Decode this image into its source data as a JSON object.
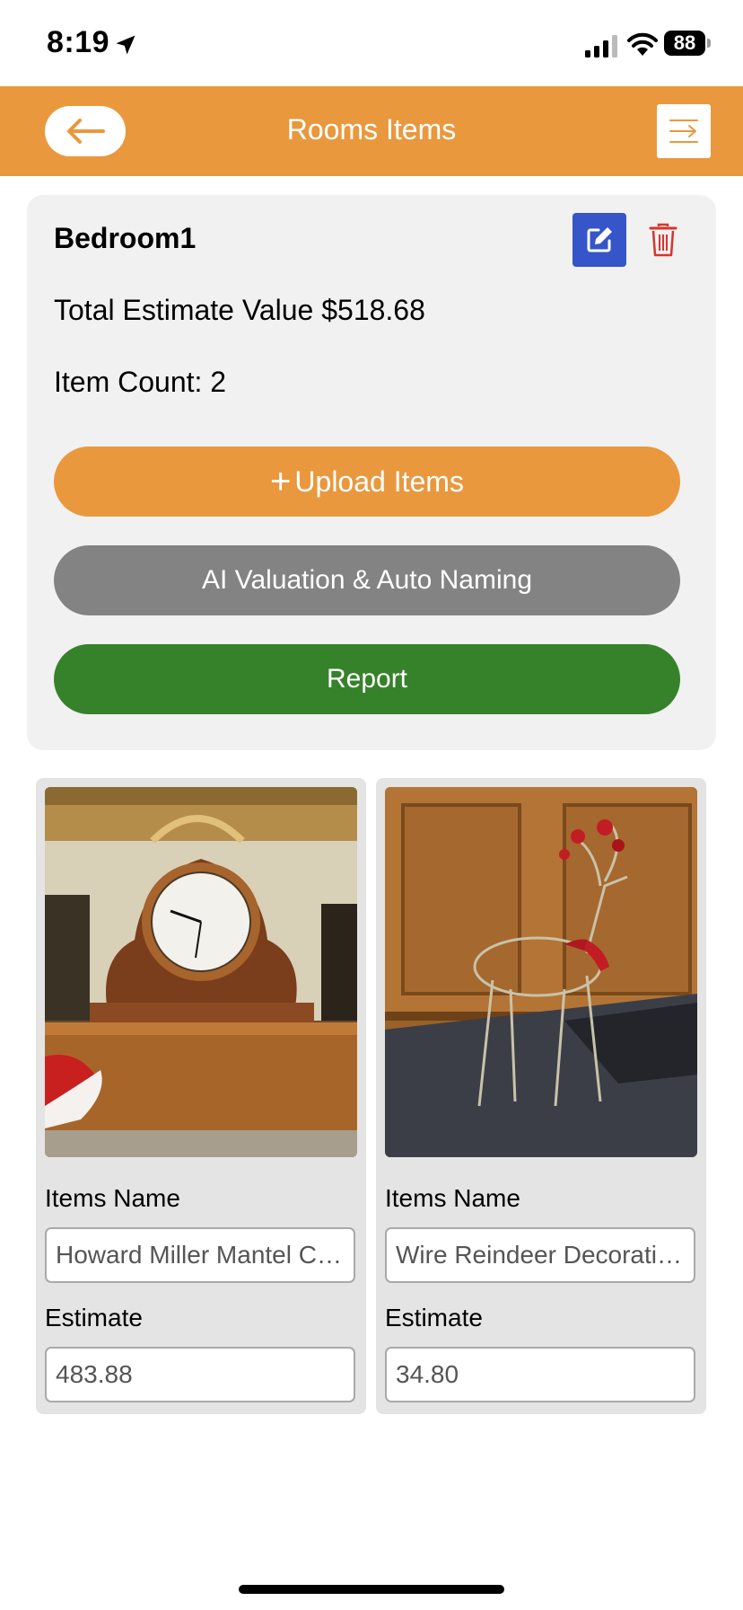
{
  "status_bar": {
    "time": "8:19",
    "battery": "88"
  },
  "header": {
    "title": "Rooms Items"
  },
  "room": {
    "name": "Bedroom1",
    "total_text": "Total Estimate Value $518.68",
    "count_text": "Item Count: 2",
    "buttons": {
      "upload": "Upload Items",
      "ai": "AI Valuation & Auto Naming",
      "report": "Report"
    }
  },
  "items": [
    {
      "name_label": "Items Name",
      "name_value": "Howard Miller Mantel Clock",
      "estimate_label": "Estimate",
      "estimate_value": "483.88"
    },
    {
      "name_label": "Items Name",
      "name_value": "Wire Reindeer Decoration",
      "estimate_label": "Estimate",
      "estimate_value": "34.80"
    }
  ],
  "colors": {
    "brand": "#E9983E",
    "edit": "#3555C9",
    "ai": "#838383",
    "report": "#36822A",
    "delete": "#D9342B"
  },
  "icons": [
    "location-arrow-icon",
    "signal-icon",
    "wifi-icon",
    "back-arrow-icon",
    "menu-icon",
    "edit-icon",
    "trash-icon",
    "plus-icon"
  ]
}
